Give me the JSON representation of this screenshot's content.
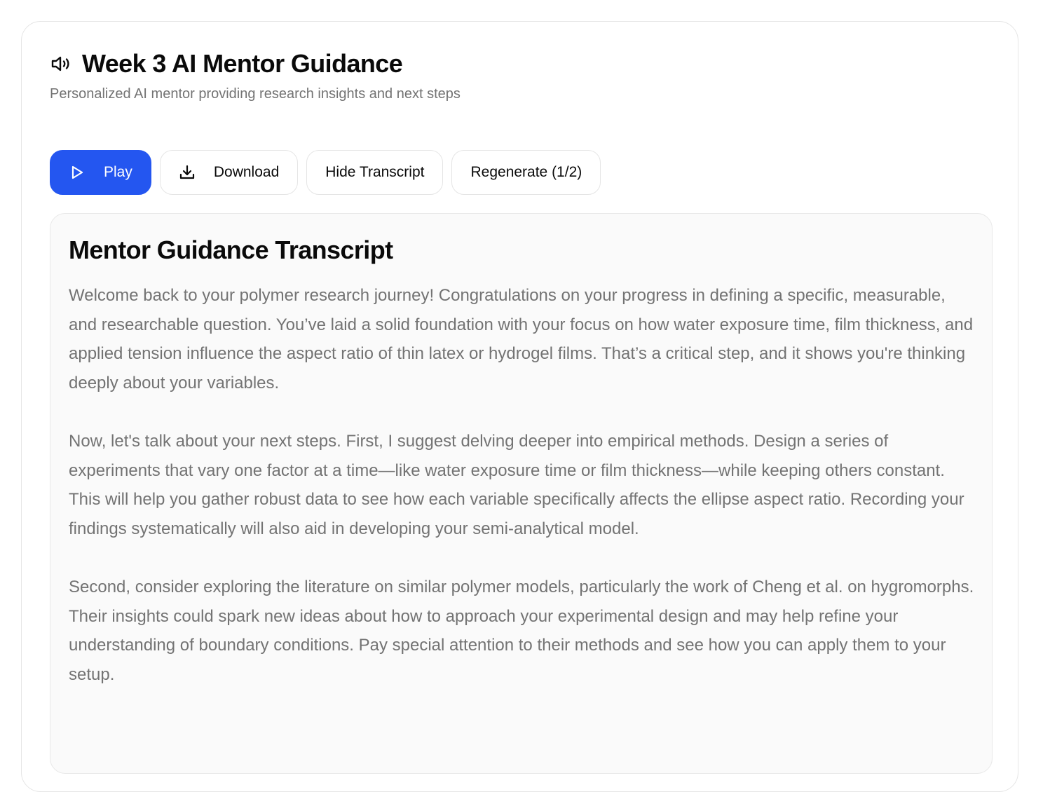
{
  "header": {
    "title": "Week 3 AI Mentor Guidance",
    "subtitle": "Personalized AI mentor providing research insights and next steps",
    "icon": "speaker-icon"
  },
  "actions": {
    "play_label": "Play",
    "download_label": "Download",
    "hide_transcript_label": "Hide Transcript",
    "regenerate_label": "Regenerate (1/2)"
  },
  "transcript": {
    "title": "Mentor Guidance Transcript",
    "paragraphs": [
      "Welcome back to your polymer research journey! Congratulations on your progress in defining a specific, measurable, and researchable question. You’ve laid a solid foundation with your focus on how water exposure time, film thickness, and applied tension influence the aspect ratio of thin latex or hydrogel films. That’s a critical step, and it shows you're thinking deeply about your variables.",
      "Now, let's talk about your next steps. First, I suggest delving deeper into empirical methods. Design a series of experiments that vary one factor at a time—like water exposure time or film thickness—while keeping others constant. This will help you gather robust data to see how each variable specifically affects the ellipse aspect ratio. Recording your findings systematically will also aid in developing your semi-analytical model.",
      "Second, consider exploring the literature on similar polymer models, particularly the work of Cheng et al. on hygromorphs. Their insights could spark new ideas about how to approach your experimental design and may help refine your understanding of boundary conditions. Pay special attention to their methods and see how you can apply them to your setup."
    ]
  },
  "colors": {
    "primary": "#2456f0",
    "muted_text": "#737373",
    "border": "#e5e5e5",
    "panel_bg": "#fafafa"
  }
}
